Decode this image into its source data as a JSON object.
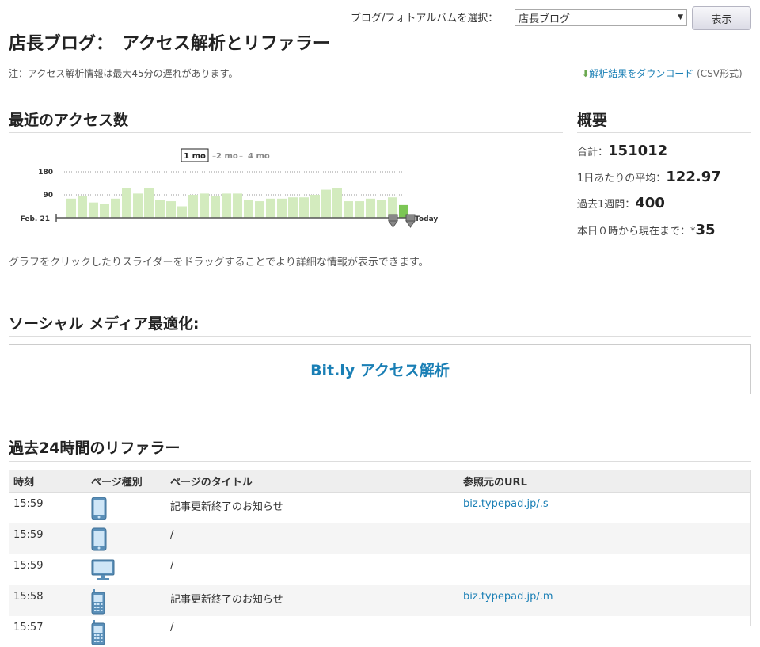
{
  "header": {
    "blog_select_label": "ブログ/フォトアルバムを選択：",
    "blog_select_value": "店長ブログ",
    "show_button": "表示",
    "page_title": "店長ブログ：　アクセス解析とリファラー",
    "note": "注：アクセス解析情報は最大45分の遅れがあります。",
    "download_link": "解析結果をダウンロード",
    "download_format": "(CSV形式)"
  },
  "recent": {
    "title": "最近のアクセス数",
    "range_options": [
      "1 mo",
      "2 mo",
      "4 mo"
    ],
    "selected_range": "1 mo",
    "help": "グラフをクリックしたりスライダーをドラッグすることでより詳細な情報が表示できます。"
  },
  "summary": {
    "title": "概要",
    "total_label": "合計：",
    "total_value": "151012",
    "daily_avg_label": "1日あたりの平均：",
    "daily_avg_value": "122.97",
    "week_label": "過去1週間：",
    "week_value": "400",
    "today_label": "本日０時から現在まで：",
    "today_prefix": "*",
    "today_value": "35"
  },
  "chart_data": {
    "type": "bar",
    "y_ticks": [
      "180",
      "90"
    ],
    "ylim": [
      0,
      180
    ],
    "x_start_label": "Feb. 21",
    "x_end_label": "Today",
    "values": [
      75,
      85,
      60,
      55,
      75,
      115,
      95,
      115,
      70,
      65,
      45,
      90,
      95,
      85,
      95,
      95,
      70,
      65,
      75,
      75,
      80,
      80,
      90,
      110,
      115,
      65,
      65,
      75,
      70,
      80,
      50
    ],
    "highlight_indices": [
      30
    ],
    "colors": {
      "bar": "#d3ebbe",
      "highlight": "#7cc655",
      "grid": "#999999"
    }
  },
  "social": {
    "title": "ソーシャル メディア最適化:",
    "bitly_link": "Bit.ly アクセス解析"
  },
  "referrers": {
    "title": "過去24時間のリファラー",
    "columns": [
      "時刻",
      "ページ種別",
      "ページのタイトル",
      "参照元のURL"
    ],
    "rows": [
      {
        "time": "15:59",
        "device": "smartphone-icon",
        "title": "記事更新終了のお知らせ",
        "url": "biz.typepad.jp/.s"
      },
      {
        "time": "15:59",
        "device": "smartphone-icon",
        "title": "/",
        "url": ""
      },
      {
        "time": "15:59",
        "device": "desktop-icon",
        "title": "/",
        "url": ""
      },
      {
        "time": "15:58",
        "device": "feature-phone-icon",
        "title": "記事更新終了のお知らせ",
        "url": "biz.typepad.jp/.m"
      },
      {
        "time": "15:57",
        "device": "feature-phone-icon",
        "title": "/",
        "url": ""
      }
    ]
  }
}
